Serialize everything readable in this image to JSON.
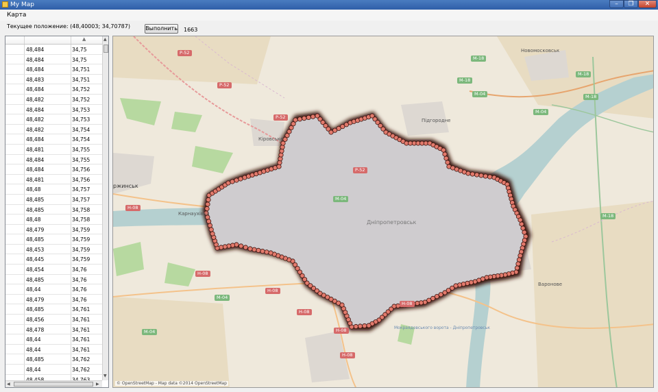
{
  "window": {
    "title": "My Map",
    "minimize": "–",
    "maximize": "❐",
    "close": "✕"
  },
  "menu": {
    "items": [
      {
        "label": "Карта"
      }
    ]
  },
  "toolbar": {
    "position_label": "Текущее положение: (48,40003; 34,70787)",
    "run_label": "Выполнить",
    "count": "1663"
  },
  "grid": {
    "rows": [
      {
        "lat": "48,484",
        "lon": "34,75"
      },
      {
        "lat": "48,484",
        "lon": "34,75"
      },
      {
        "lat": "48,484",
        "lon": "34,751"
      },
      {
        "lat": "48,483",
        "lon": "34,751"
      },
      {
        "lat": "48,484",
        "lon": "34,752"
      },
      {
        "lat": "48,482",
        "lon": "34,752"
      },
      {
        "lat": "48,484",
        "lon": "34,753"
      },
      {
        "lat": "48,482",
        "lon": "34,753"
      },
      {
        "lat": "48,482",
        "lon": "34,754"
      },
      {
        "lat": "48,484",
        "lon": "34,754"
      },
      {
        "lat": "48,481",
        "lon": "34,755"
      },
      {
        "lat": "48,484",
        "lon": "34,755"
      },
      {
        "lat": "48,484",
        "lon": "34,756"
      },
      {
        "lat": "48,481",
        "lon": "34,756"
      },
      {
        "lat": "48,48",
        "lon": "34,757"
      },
      {
        "lat": "48,485",
        "lon": "34,757"
      },
      {
        "lat": "48,485",
        "lon": "34,758"
      },
      {
        "lat": "48,48",
        "lon": "34,758"
      },
      {
        "lat": "48,479",
        "lon": "34,759"
      },
      {
        "lat": "48,485",
        "lon": "34,759"
      },
      {
        "lat": "48,453",
        "lon": "34,759"
      },
      {
        "lat": "48,445",
        "lon": "34,759"
      },
      {
        "lat": "48,454",
        "lon": "34,76"
      },
      {
        "lat": "48,485",
        "lon": "34,76"
      },
      {
        "lat": "48,44",
        "lon": "34,76"
      },
      {
        "lat": "48,479",
        "lon": "34,76"
      },
      {
        "lat": "48,485",
        "lon": "34,761"
      },
      {
        "lat": "48,456",
        "lon": "34,761"
      },
      {
        "lat": "48,478",
        "lon": "34,761"
      },
      {
        "lat": "48,44",
        "lon": "34,761"
      },
      {
        "lat": "48,44",
        "lon": "34,761"
      },
      {
        "lat": "48,485",
        "lon": "34,762"
      },
      {
        "lat": "48,44",
        "lon": "34,762"
      },
      {
        "lat": "48,458",
        "lon": "34,763"
      }
    ]
  },
  "map": {
    "labels": {
      "dnipro": "Дніпропетровськ",
      "novomoskovsk": "Новомосковськ",
      "pidhorodne": "Підгородне",
      "kirovske": "Кіровське",
      "karnaukhivka": "Карнаухівка",
      "dniprodzerzhynsk": "ржинськ",
      "varonove": "Варонове",
      "reservoir": "Мокраядовського ворота - Дніпропетровськ"
    },
    "shields": {
      "p52_a": "Р-52",
      "p52_b": "Р-52",
      "p52_c": "Р-52",
      "p52_d": "Р-52",
      "m18_a": "М-18",
      "m18_b": "М-18",
      "m18_c": "М-18",
      "m18_d": "М-18",
      "m18_e": "М-18",
      "m04_a": "М-04",
      "m04_b": "М-04",
      "m04_c": "М-04",
      "m04_d": "М-04",
      "m04_e": "М-04",
      "h08_a": "Н-08",
      "h08_b": "Н-08",
      "h08_c": "Н-08",
      "h08_d": "Н-08",
      "h08_e": "Н-08",
      "h08_f": "Н-08",
      "h08_g": "Н-08"
    },
    "copyright": "© OpenStreetMap - Map data ©2014 OpenStreetMap",
    "colors": {
      "outline": "#3a1410",
      "marker": "#e27a6c",
      "region_fill": "#e4e6ea"
    }
  }
}
